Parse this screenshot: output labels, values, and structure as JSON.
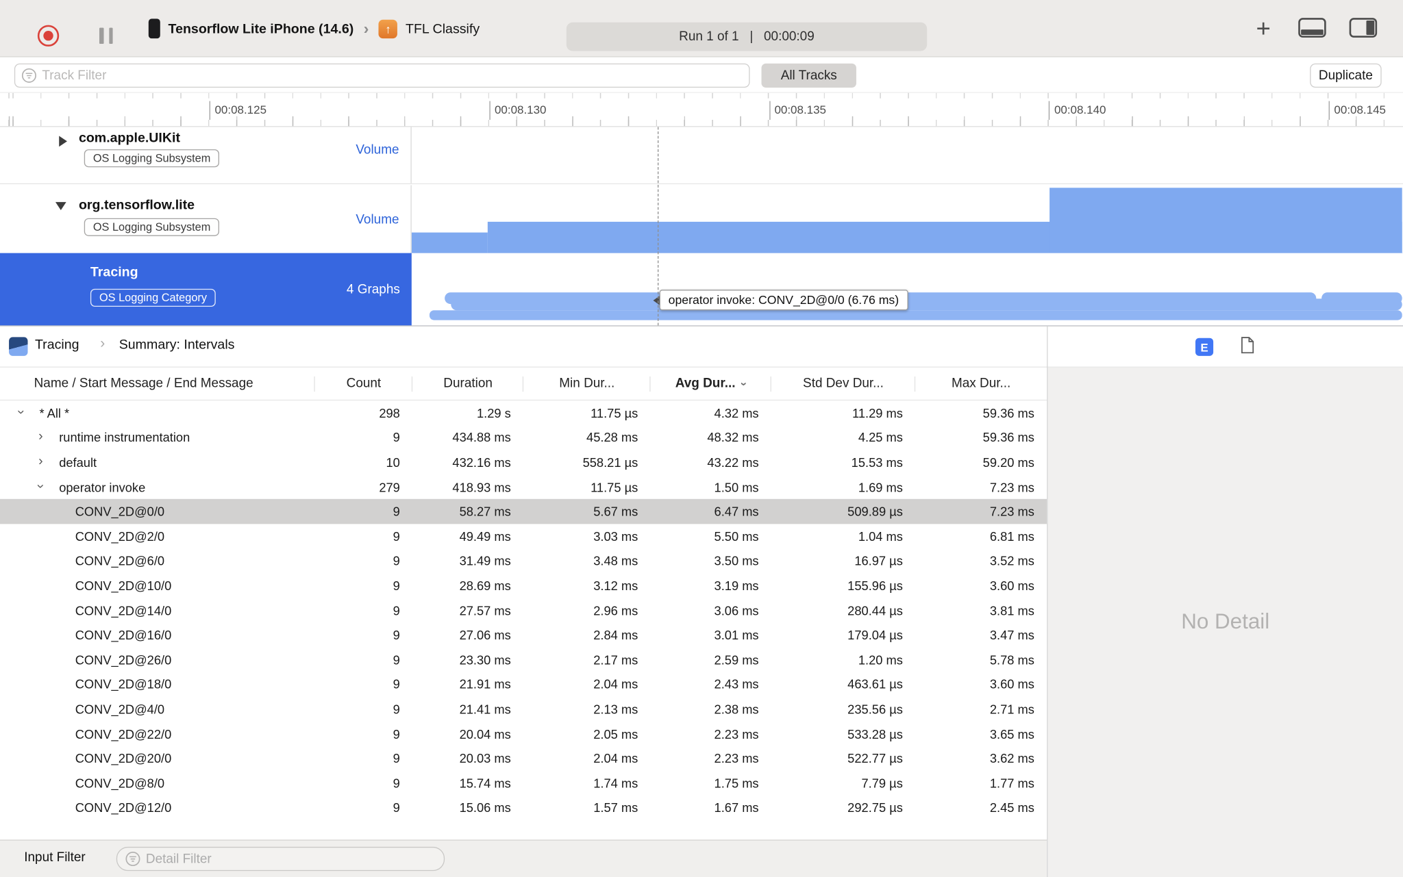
{
  "toolbar": {
    "device_name": "Tensorflow Lite iPhone (14.6)",
    "app_name": "TFL Classify",
    "run_label": "Run 1 of 1   |   00:00:09"
  },
  "filter_bar": {
    "track_filter_placeholder": "Track Filter",
    "all_tracks": "All Tracks",
    "duplicate": "Duplicate"
  },
  "ruler": {
    "labels": [
      "00:08.125",
      "00:08.130",
      "00:08.135",
      "00:08.140",
      "00:08.145"
    ]
  },
  "tracks": [
    {
      "name": "com.apple.UIKit",
      "badge": "OS Logging Subsystem",
      "stat": "Volume"
    },
    {
      "name": "org.tensorflow.lite",
      "badge": "OS Logging Subsystem",
      "stat": "Volume"
    },
    {
      "name": "Tracing",
      "badge": "OS Logging Category",
      "stat": "4 Graphs"
    }
  ],
  "timeline_tooltip": "operator invoke: CONV_2D@0/0 (6.76 ms)",
  "detail_pane": {
    "breadcrumb_root": "Tracing",
    "breadcrumb_separator": "›",
    "breadcrumb_current": "Summary: Intervals",
    "extended_detail_label": "E",
    "no_detail": "No Detail",
    "input_filter_label": "Input Filter",
    "detail_filter_placeholder": "Detail Filter"
  },
  "table": {
    "columns": [
      "Name / Start Message / End Message",
      "Count",
      "Duration",
      "Min Dur...",
      "Avg Dur...",
      "Std Dev Dur...",
      "Max Dur..."
    ],
    "sorted_column": "Avg Dur...",
    "rows": [
      {
        "name": "* All *",
        "level": 0,
        "disclosure": "expanded",
        "selected": false,
        "values": [
          "298",
          "1.29 s",
          "11.75 µs",
          "4.32 ms",
          "11.29 ms",
          "59.36 ms"
        ]
      },
      {
        "name": "runtime instrumentation",
        "level": 1,
        "disclosure": "collapsed",
        "selected": false,
        "values": [
          "9",
          "434.88 ms",
          "45.28 ms",
          "48.32 ms",
          "4.25 ms",
          "59.36 ms"
        ]
      },
      {
        "name": "default",
        "level": 1,
        "disclosure": "collapsed",
        "selected": false,
        "values": [
          "10",
          "432.16 ms",
          "558.21 µs",
          "43.22 ms",
          "15.53 ms",
          "59.20 ms"
        ]
      },
      {
        "name": "operator invoke",
        "level": 1,
        "disclosure": "expanded",
        "selected": false,
        "values": [
          "279",
          "418.93 ms",
          "11.75 µs",
          "1.50 ms",
          "1.69 ms",
          "7.23 ms"
        ]
      },
      {
        "name": "CONV_2D@0/0",
        "level": 2,
        "disclosure": null,
        "selected": true,
        "values": [
          "9",
          "58.27 ms",
          "5.67 ms",
          "6.47 ms",
          "509.89 µs",
          "7.23 ms"
        ]
      },
      {
        "name": "CONV_2D@2/0",
        "level": 2,
        "disclosure": null,
        "selected": false,
        "values": [
          "9",
          "49.49 ms",
          "3.03 ms",
          "5.50 ms",
          "1.04 ms",
          "6.81 ms"
        ]
      },
      {
        "name": "CONV_2D@6/0",
        "level": 2,
        "disclosure": null,
        "selected": false,
        "values": [
          "9",
          "31.49 ms",
          "3.48 ms",
          "3.50 ms",
          "16.97 µs",
          "3.52 ms"
        ]
      },
      {
        "name": "CONV_2D@10/0",
        "level": 2,
        "disclosure": null,
        "selected": false,
        "values": [
          "9",
          "28.69 ms",
          "3.12 ms",
          "3.19 ms",
          "155.96 µs",
          "3.60 ms"
        ]
      },
      {
        "name": "CONV_2D@14/0",
        "level": 2,
        "disclosure": null,
        "selected": false,
        "values": [
          "9",
          "27.57 ms",
          "2.96 ms",
          "3.06 ms",
          "280.44 µs",
          "3.81 ms"
        ]
      },
      {
        "name": "CONV_2D@16/0",
        "level": 2,
        "disclosure": null,
        "selected": false,
        "values": [
          "9",
          "27.06 ms",
          "2.84 ms",
          "3.01 ms",
          "179.04 µs",
          "3.47 ms"
        ]
      },
      {
        "name": "CONV_2D@26/0",
        "level": 2,
        "disclosure": null,
        "selected": false,
        "values": [
          "9",
          "23.30 ms",
          "2.17 ms",
          "2.59 ms",
          "1.20 ms",
          "5.78 ms"
        ]
      },
      {
        "name": "CONV_2D@18/0",
        "level": 2,
        "disclosure": null,
        "selected": false,
        "values": [
          "9",
          "21.91 ms",
          "2.04 ms",
          "2.43 ms",
          "463.61 µs",
          "3.60 ms"
        ]
      },
      {
        "name": "CONV_2D@4/0",
        "level": 2,
        "disclosure": null,
        "selected": false,
        "values": [
          "9",
          "21.41 ms",
          "2.13 ms",
          "2.38 ms",
          "235.56 µs",
          "2.71 ms"
        ]
      },
      {
        "name": "CONV_2D@22/0",
        "level": 2,
        "disclosure": null,
        "selected": false,
        "values": [
          "9",
          "20.04 ms",
          "2.05 ms",
          "2.23 ms",
          "533.28 µs",
          "3.65 ms"
        ]
      },
      {
        "name": "CONV_2D@20/0",
        "level": 2,
        "disclosure": null,
        "selected": false,
        "values": [
          "9",
          "20.03 ms",
          "2.04 ms",
          "2.23 ms",
          "522.77 µs",
          "3.62 ms"
        ]
      },
      {
        "name": "CONV_2D@8/0",
        "level": 2,
        "disclosure": null,
        "selected": false,
        "values": [
          "9",
          "15.74 ms",
          "1.74 ms",
          "1.75 ms",
          "7.79 µs",
          "1.77 ms"
        ]
      },
      {
        "name": "CONV_2D@12/0",
        "level": 2,
        "disclosure": null,
        "selected": false,
        "values": [
          "9",
          "15.06 ms",
          "1.57 ms",
          "1.67 ms",
          "292.75 µs",
          "2.45 ms"
        ]
      }
    ]
  }
}
